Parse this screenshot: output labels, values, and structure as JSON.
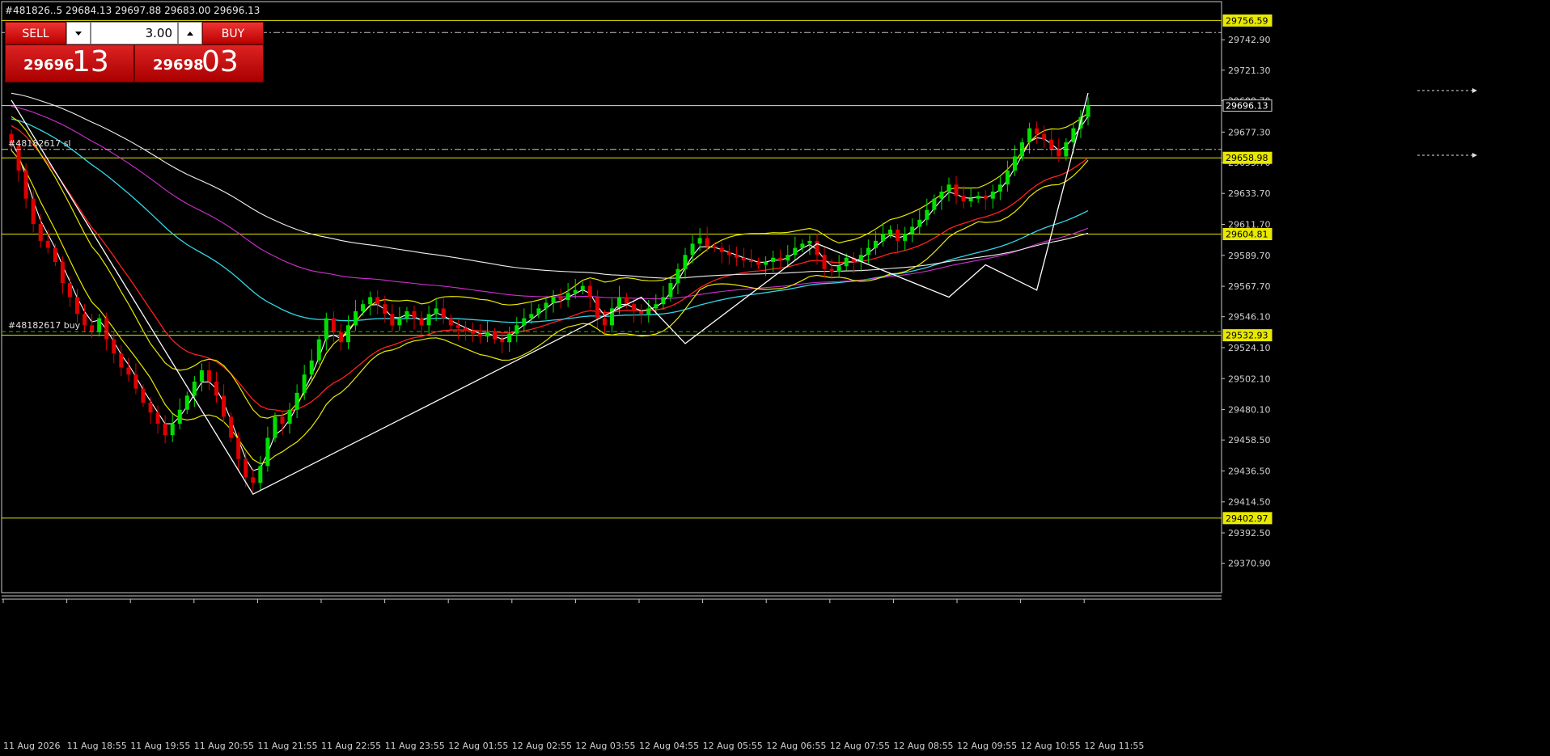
{
  "header": {
    "ohlc_text": "#481826..5  29684.13 29697.88 29683.00 29696.13"
  },
  "trade_panel": {
    "sell_label": "SELL",
    "buy_label": "BUY",
    "volume": "3.00",
    "sell_price_main": "29696",
    "sell_price_pips": "13",
    "buy_price_main": "29698",
    "buy_price_pips": "03"
  },
  "price_axis": {
    "ticks": [
      "29742.90",
      "29721.30",
      "29699.70",
      "29677.30",
      "29655.70",
      "29633.70",
      "29611.70",
      "29589.70",
      "29567.70",
      "29546.10",
      "29524.10",
      "29502.10",
      "29480.10",
      "29458.50",
      "29436.50",
      "29414.50",
      "29392.50",
      "29370.90"
    ],
    "tags": [
      {
        "value": "29756.59",
        "style": "yellow"
      },
      {
        "value": "29696.13",
        "style": "white"
      },
      {
        "value": "29658.98",
        "style": "yellow"
      },
      {
        "value": "29604.81",
        "style": "yellow"
      },
      {
        "value": "29532.93",
        "style": "yellow"
      },
      {
        "value": "29402.97",
        "style": "yellow"
      }
    ]
  },
  "time_axis": {
    "labels": [
      "11 Aug 2026",
      "11 Aug 18:55",
      "11 Aug 19:55",
      "11 Aug 20:55",
      "11 Aug 21:55",
      "11 Aug 22:55",
      "11 Aug 23:55",
      "12 Aug 01:55",
      "12 Aug 02:55",
      "12 Aug 03:55",
      "12 Aug 04:55",
      "12 Aug 05:55",
      "12 Aug 06:55",
      "12 Aug 07:55",
      "12 Aug 08:55",
      "12 Aug 09:55",
      "12 Aug 10:55",
      "12 Aug 11:55"
    ]
  },
  "orders": [
    {
      "label": "#48182617 sl"
    },
    {
      "label": "#48182617 buy"
    }
  ],
  "colors": {
    "background": "#000000",
    "bull": "#00e000",
    "bear": "#e00000",
    "level": "#e8e800",
    "trade_btn": "#cc1111"
  },
  "chart_data": {
    "type": "candlestick",
    "ylim": [
      29350,
      29770
    ],
    "horizontal_levels": [
      29756.59,
      29658.98,
      29604.81,
      29532.93,
      29402.97
    ],
    "current_price": 29696.13,
    "order_lines": [
      {
        "label": "#48182617 sl",
        "price": 29665.0
      },
      {
        "label": "#48182617 buy",
        "price": 29535.5
      }
    ],
    "close": [
      29668,
      29650,
      29630,
      29612,
      29600,
      29595,
      29585,
      29570,
      29560,
      29548,
      29540,
      29535,
      29545,
      29530,
      29520,
      29510,
      29505,
      29495,
      29485,
      29478,
      29470,
      29462,
      29470,
      29480,
      29490,
      29500,
      29508,
      29500,
      29490,
      29475,
      29460,
      29445,
      29432,
      29428,
      29440,
      29460,
      29475,
      29470,
      29480,
      29492,
      29505,
      29515,
      29530,
      29545,
      29535,
      29528,
      29540,
      29550,
      29555,
      29560,
      29555,
      29548,
      29540,
      29545,
      29550,
      29545,
      29540,
      29548,
      29552,
      29545,
      29540,
      29538,
      29536,
      29534,
      29532,
      29535,
      29530,
      29528,
      29534,
      29540,
      29545,
      29548,
      29552,
      29556,
      29560,
      29558,
      29563,
      29565,
      29568,
      29560,
      29545,
      29540,
      29552,
      29560,
      29555,
      29550,
      29548,
      29552,
      29555,
      29560,
      29570,
      29580,
      29590,
      29598,
      29602,
      29596,
      29595,
      29592,
      29590,
      29588,
      29586,
      29585,
      29583,
      29585,
      29588,
      29586,
      29590,
      29595,
      29598,
      29600,
      29590,
      29580,
      29578,
      29582,
      29588,
      29585,
      29590,
      29595,
      29600,
      29605,
      29608,
      29600,
      29605,
      29610,
      29615,
      29622,
      29630,
      29635,
      29640,
      29632,
      29628,
      29630,
      29632,
      29630,
      29635,
      29640,
      29650,
      29660,
      29670,
      29680,
      29676,
      29672,
      29665,
      29660,
      29670,
      29680,
      29688,
      29696
    ]
  }
}
